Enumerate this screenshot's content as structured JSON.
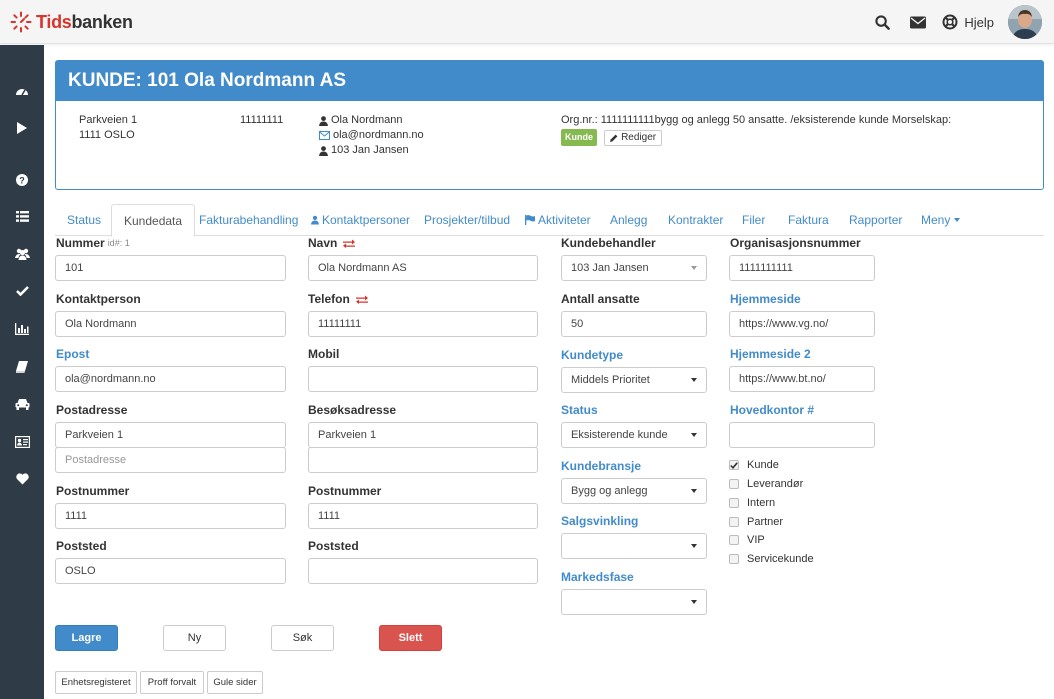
{
  "app": {
    "brand_prefix": "Tids",
    "brand_suffix": "banken",
    "help_label": "Hjelp"
  },
  "colors": {
    "primary": "#428bca",
    "danger": "#d9534f",
    "success": "#86b94f",
    "sidebar": "#2f3b46",
    "brand_red": "#d9342b"
  },
  "sidebar": {
    "items": [
      {
        "icon": "dashboard-icon"
      },
      {
        "icon": "play-icon"
      },
      {
        "icon": "question-icon"
      },
      {
        "icon": "list-icon"
      },
      {
        "icon": "users-icon"
      },
      {
        "icon": "check-icon"
      },
      {
        "icon": "bar-chart-icon"
      },
      {
        "icon": "book-icon"
      },
      {
        "icon": "car-icon"
      },
      {
        "icon": "id-card-icon"
      },
      {
        "icon": "heart-icon"
      }
    ]
  },
  "header": {
    "title": "KUNDE: 101 Ola Nordmann AS",
    "address_line1": "Parkveien 1",
    "address_line2": "1111 OSLO",
    "phone": "11111111",
    "contact_name": "Ola Nordmann",
    "contact_email": "ola@nordmann.no",
    "handler": "103 Jan Jansen",
    "org_info": "Org.nr.: 1111111111bygg og anlegg 50 ansatte. /eksisterende kunde Morselskap:",
    "badge": "Kunde",
    "edit_label": "Rediger"
  },
  "tabs": [
    {
      "label": "Status"
    },
    {
      "label": "Kundedata",
      "active": true
    },
    {
      "label": "Fakturabehandling"
    },
    {
      "label": "Kontaktpersoner"
    },
    {
      "label": "Prosjekter/tilbud"
    },
    {
      "label": "Aktiviteter"
    },
    {
      "label": "Anlegg"
    },
    {
      "label": "Kontrakter"
    },
    {
      "label": "Filer"
    },
    {
      "label": "Faktura"
    },
    {
      "label": "Rapporter"
    },
    {
      "label": "Meny"
    }
  ],
  "form": {
    "nummer": {
      "label": "Nummer",
      "hint": "id#: 1",
      "value": "101"
    },
    "navn": {
      "label": "Navn",
      "value": "Ola Nordmann AS"
    },
    "kundebehandler": {
      "label": "Kundebehandler",
      "value": "103 Jan Jansen"
    },
    "orgnr": {
      "label": "Organisasjonsnummer",
      "value": "1111111111"
    },
    "kontaktperson": {
      "label": "Kontaktperson",
      "value": "Ola Nordmann"
    },
    "telefon": {
      "label": "Telefon",
      "value": "11111111"
    },
    "antall": {
      "label": "Antall ansatte",
      "value": "50"
    },
    "hjemmeside": {
      "label": "Hjemmeside",
      "value": "https://www.vg.no/"
    },
    "epost": {
      "label": "Epost",
      "value": "ola@nordmann.no"
    },
    "mobil": {
      "label": "Mobil",
      "value": ""
    },
    "kundetype": {
      "label": "Kundetype",
      "value": "Middels Prioritet"
    },
    "hjemmeside2": {
      "label": "Hjemmeside 2",
      "value": "https://www.bt.no/"
    },
    "postadresse": {
      "label": "Postadresse",
      "value": "Parkveien 1",
      "placeholder": "Postadresse"
    },
    "besoksadresse": {
      "label": "Besøksadresse",
      "value": "Parkveien 1",
      "value2": ""
    },
    "status": {
      "label": "Status",
      "value": "Eksisterende kunde"
    },
    "hovedkontor": {
      "label": "Hovedkontor #",
      "value": ""
    },
    "kundebransje": {
      "label": "Kundebransje",
      "value": "Bygg og anlegg"
    },
    "postnummer": {
      "label": "Postnummer",
      "value": "1111"
    },
    "postnummer2": {
      "label": "Postnummer",
      "value": "1111"
    },
    "salgsvinkling": {
      "label": "Salgsvinkling",
      "value": ""
    },
    "poststed": {
      "label": "Poststed",
      "value": "OSLO"
    },
    "poststed2": {
      "label": "Poststed",
      "value": ""
    },
    "markedsfase": {
      "label": "Markedsfase",
      "value": ""
    },
    "checkboxes": [
      {
        "label": "Kunde",
        "checked": true
      },
      {
        "label": "Leverandør",
        "checked": false
      },
      {
        "label": "Intern",
        "checked": false
      },
      {
        "label": "Partner",
        "checked": false
      },
      {
        "label": "VIP",
        "checked": false
      },
      {
        "label": "Servicekunde",
        "checked": false
      }
    ]
  },
  "actions": {
    "save": "Lagre",
    "new": "Ny",
    "search": "Søk",
    "delete": "Slett"
  },
  "registers": {
    "enhet": "Enhetsregisteret",
    "proff": "Proff forvalt",
    "gule": "Gule sider"
  }
}
